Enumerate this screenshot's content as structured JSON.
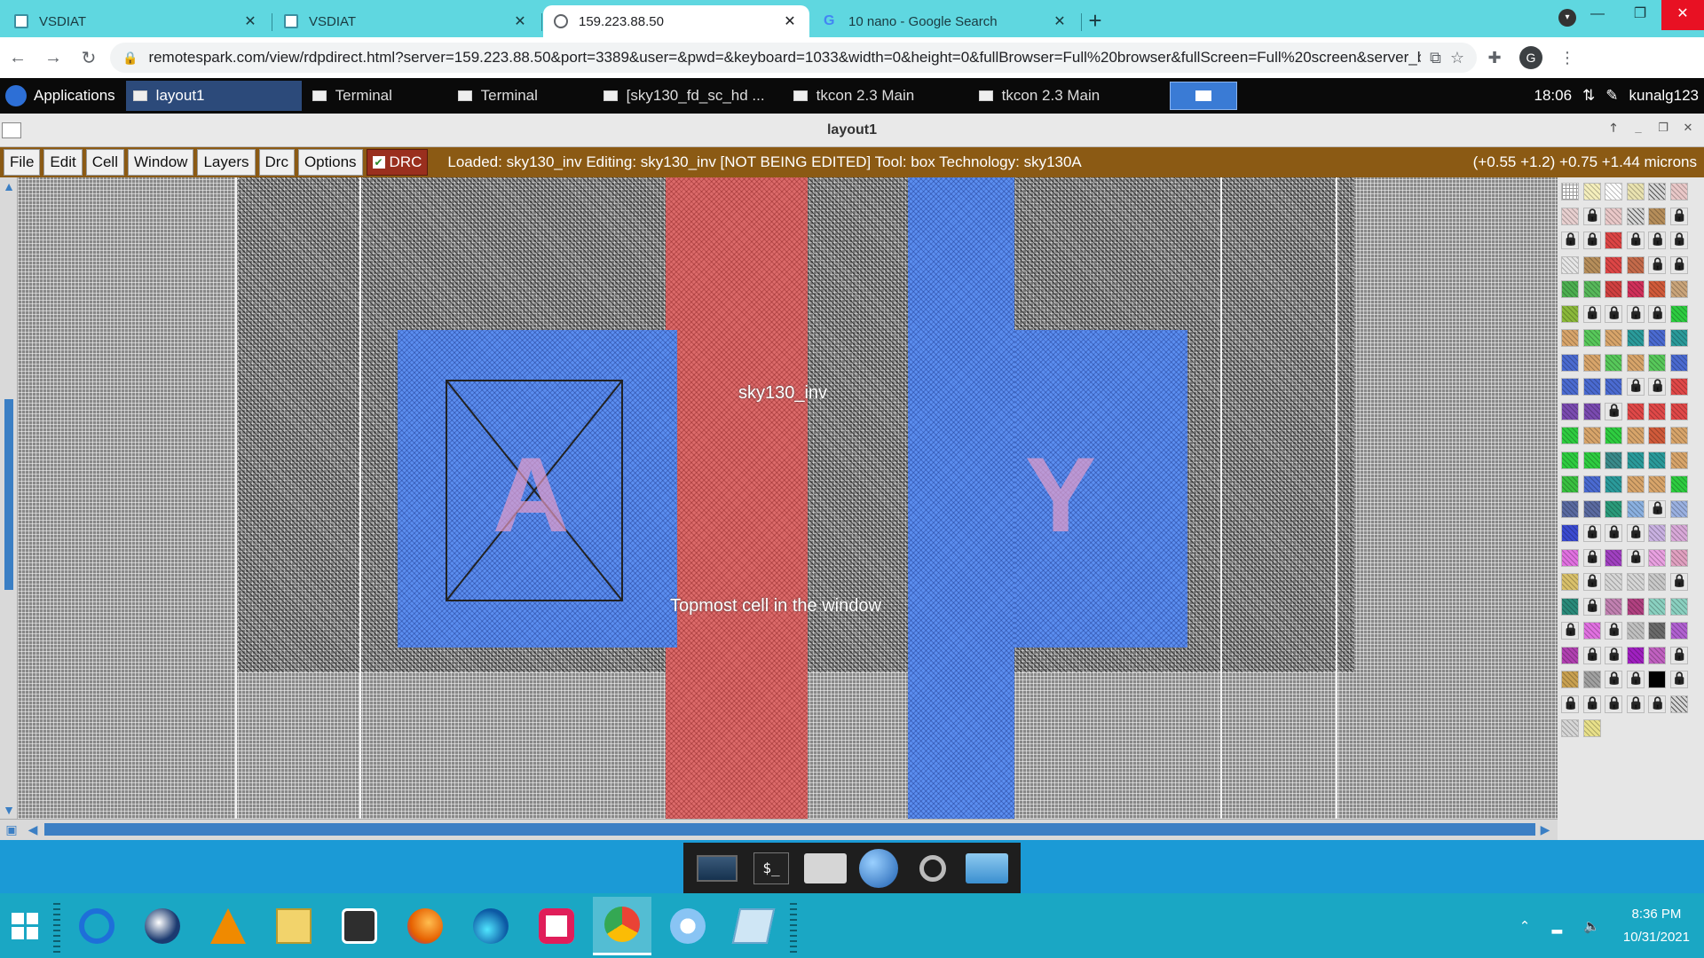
{
  "browser": {
    "tabs": [
      {
        "title": "VSDIAT",
        "favicon": "vsdiat-icon",
        "active": false
      },
      {
        "title": "VSDIAT",
        "favicon": "vsdiat-icon",
        "active": false
      },
      {
        "title": "159.223.88.50",
        "favicon": "globe-icon",
        "active": true
      },
      {
        "title": "10 nano - Google Search",
        "favicon": "google-icon",
        "active": false
      }
    ],
    "new_tab": "+",
    "url": "remotespark.com/view/rdpdirect.html?server=159.223.88.50&port=3389&user=&pwd=&keyboard=1033&width=0&height=0&fullBrowser=Full%20browser&fullScreen=Full%20screen&server_b...",
    "profile_initial": "G"
  },
  "remote_panel": {
    "applications": "Applications",
    "tasks": [
      {
        "label": "layout1",
        "active": true
      },
      {
        "label": "Terminal",
        "active": false
      },
      {
        "label": "Terminal",
        "active": false
      },
      {
        "label": "[sky130_fd_sc_hd ...",
        "active": false
      },
      {
        "label": "tkcon 2.3 Main",
        "active": false
      },
      {
        "label": "tkcon 2.3 Main",
        "active": false
      }
    ],
    "time": "18:06",
    "user": "kunalg123"
  },
  "magic": {
    "window_title": "layout1",
    "menus": [
      "File",
      "Edit",
      "Cell",
      "Window",
      "Layers",
      "Drc",
      "Options"
    ],
    "drc_label": "DRC",
    "status": "Loaded: sky130_inv Editing: sky130_inv [NOT BEING EDITED] Tool: box  Technology: sky130A",
    "coords": "(+0.55 +1.2) +0.75 +1.44 microns",
    "cell_name": "sky130_inv",
    "cell_caption": "Topmost cell in the window",
    "port_a": "A",
    "port_y": "Y",
    "colors": {
      "menubar": "#8b5a14",
      "poly": "#dc6a6a",
      "locali": "#5b8ef0",
      "scroll": "#3b7fc4"
    }
  },
  "palette": [
    [
      "#ffffff:grid",
      "#f4eebc",
      "#ffffff",
      "#e9e2b0",
      "#d6d6d6:hatch",
      "#e9c8c8"
    ],
    [
      "#e7cfcf",
      "#e6e6e6:lock",
      "#e9c8c8",
      "#d6d6d6:hatch",
      "#b58d5a",
      "#e6e6e6:lock"
    ],
    [
      "#e6e6e6:lock",
      "#e6e6e6:lock",
      "#dc4545",
      "#e6e6e6:lock",
      "#e6e6e6:lock",
      "#e6e6e6:lock"
    ],
    [
      "#e6e6e6",
      "#b58d5a",
      "#dc4545",
      "#c46a4a",
      "#e6e6e6:lock",
      "#e6e6e6:lock"
    ],
    [
      "#4caf50",
      "#57b85a",
      "#d04040",
      "#d0305a",
      "#d05a3a",
      "#c9a47a"
    ],
    [
      "#8ab83a",
      "#e6e6e6:lock",
      "#e6e6e6:lock",
      "#e6e6e6:lock",
      "#e6e6e6:lock",
      "#2ecc40"
    ],
    [
      "#d7a46a",
      "#57c85a",
      "#d7a46a",
      "#2a9a9a",
      "#4a6ad0",
      "#2a9a9a"
    ],
    [
      "#4a6ad0",
      "#d7a46a",
      "#57c85a",
      "#d7a46a",
      "#57c85a",
      "#4a6ad0"
    ],
    [
      "#4a6ad0",
      "#4a6ad0",
      "#4a6ad0",
      "#e6e6e6:lock",
      "#e6e6e6:lock",
      "#e04848"
    ],
    [
      "#7a4ab0",
      "#7a4ab0",
      "#e6e6e6:lock",
      "#e04848",
      "#e04848",
      "#e04848"
    ],
    [
      "#2ecc40",
      "#d7a46a",
      "#2ecc40",
      "#d7a46a",
      "#d05a3a",
      "#d7a46a"
    ],
    [
      "#2ecc40",
      "#2ecc40",
      "#3a8a8a",
      "#2a9a9a",
      "#2a9a9a",
      "#d7a46a"
    ],
    [
      "#3ac040",
      "#4a6ad0",
      "#2a9a9a",
      "#d7a46a",
      "#d7a46a",
      "#2ecc40"
    ],
    [
      "#5a6aa0",
      "#5a6aa0",
      "#2a9a7a",
      "#8ab0e0",
      "#e6e6e6:lock",
      "#9ab0e0"
    ],
    [
      "#3a4ad0",
      "#e6e6e6:lock",
      "#e6e6e6:lock",
      "#e6e6e6:lock",
      "#c8b0e0",
      "#d8a8d8"
    ],
    [
      "#e070e0",
      "#e6e6e6:lock",
      "#a040c0",
      "#e6e6e6:lock",
      "#e8a0e0",
      "#e0a0c0"
    ],
    [
      "#d8c06a",
      "#e6e6e6:lock",
      "#d6d6d6",
      "#d6d6d6",
      "#c8c8c8",
      "#e6e6e6:lock"
    ],
    [
      "#2a8a7a",
      "#e6e6e6:lock",
      "#c080b0",
      "#b04080",
      "#8ad0c0",
      "#8ad0c0"
    ],
    [
      "#e6e6e6:lock",
      "#e070e0",
      "#e6e6e6:lock",
      "#c0c0c0",
      "#6a6a6a",
      "#b060d0"
    ],
    [
      "#b040b0",
      "#e6e6e6:lock",
      "#e6e6e6:lock",
      "#a020c0",
      "#c060c0",
      "#e6e6e6:lock"
    ],
    [
      "#c8a050",
      "#a0a0a0",
      "#e6e6e6:lock",
      "#e6e6e6:lock",
      "#000000",
      "#e6e6e6:lock"
    ],
    [
      "#e6e6e6:lock",
      "#e6e6e6:lock",
      "#e6e6e6:lock",
      "#e6e6e6:lock",
      "#e6e6e6:lock",
      "#d6d6d6:hatch"
    ],
    [
      "#d6d6d6",
      "#e8e08a"
    ]
  ],
  "taskbar": {
    "pinned": [
      {
        "name": "ie-icon"
      },
      {
        "name": "thunderbird-icon"
      },
      {
        "name": "vlc-icon"
      },
      {
        "name": "file-explorer-icon"
      },
      {
        "name": "app-icon"
      },
      {
        "name": "firefox-icon"
      },
      {
        "name": "edge-icon"
      },
      {
        "name": "slack-icon"
      },
      {
        "name": "chrome-icon",
        "active": true
      },
      {
        "name": "paint-icon"
      },
      {
        "name": "notepad-icon"
      }
    ],
    "time": "8:36 PM",
    "date": "10/31/2021"
  }
}
